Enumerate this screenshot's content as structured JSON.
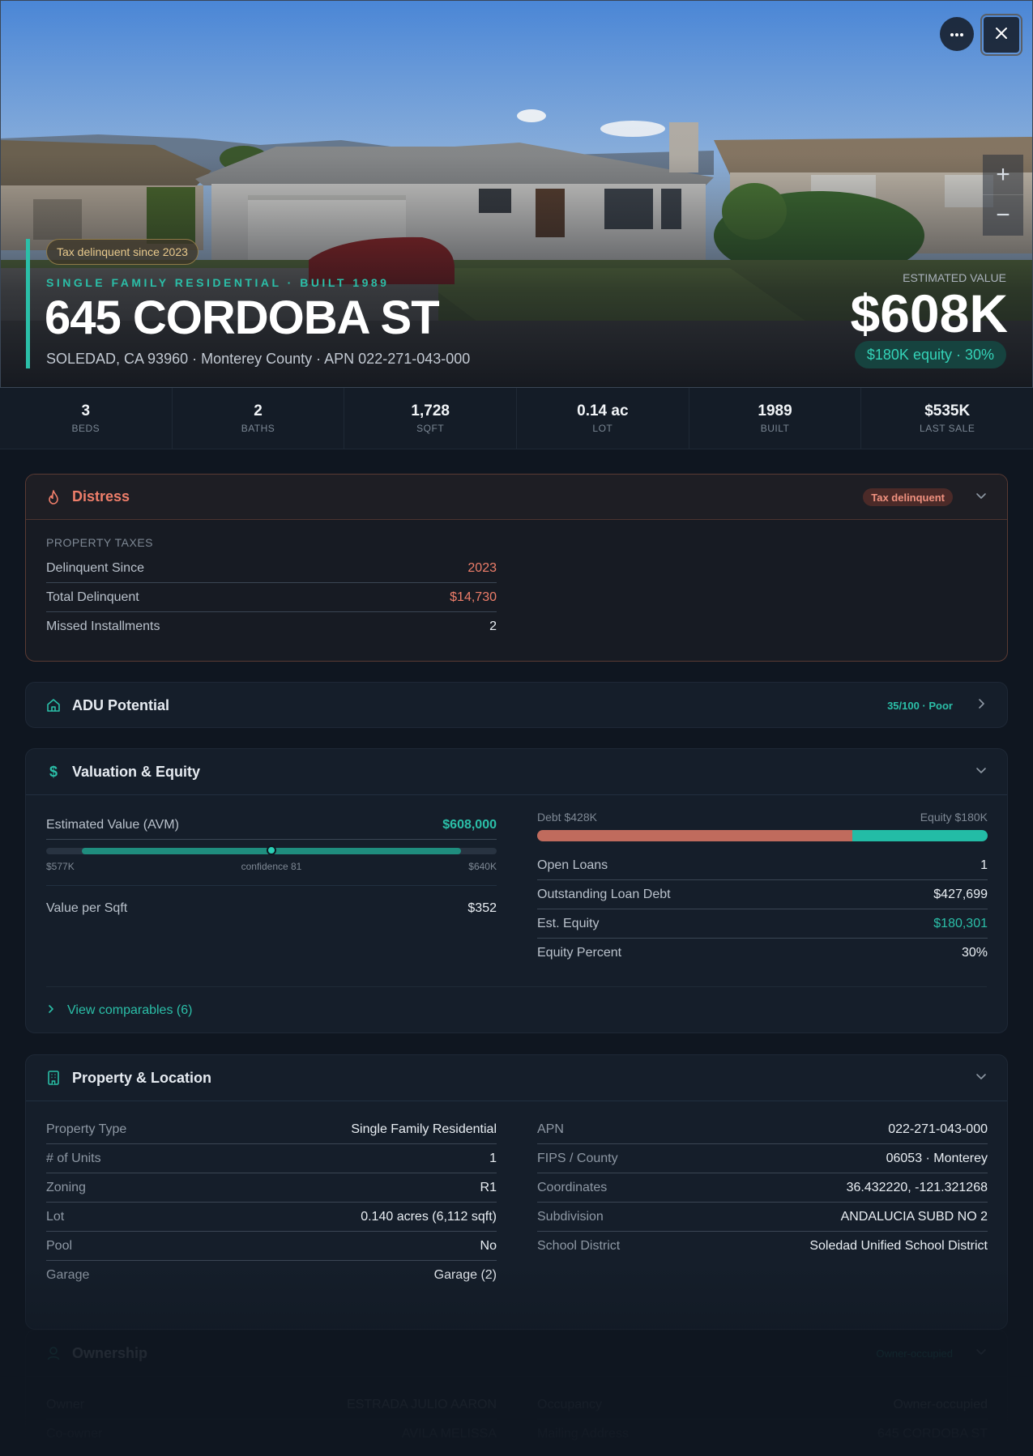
{
  "hero": {
    "tax_chip": "Tax delinquent since 2023",
    "property_type_line": "SINGLE FAMILY RESIDENTIAL · BUILT 1989",
    "address": "645 CORDOBA ST",
    "sub_address": "SOLEDAD, CA 93960 · Monterey County · APN 022-271-043-000",
    "estimated_value_label": "ESTIMATED VALUE",
    "estimated_value": "$608K",
    "equity_chip": "$180K equity · 30%",
    "more_icon": "more-horizontal-icon",
    "close_icon": "close-icon",
    "zoom_in_label": "+",
    "zoom_out_label": "−"
  },
  "stats": [
    {
      "value": "3",
      "label": "BEDS"
    },
    {
      "value": "2",
      "label": "BATHS"
    },
    {
      "value": "1,728",
      "label": "SQFT"
    },
    {
      "value": "0.14 ac",
      "label": "LOT"
    },
    {
      "value": "1989",
      "label": "BUILT"
    },
    {
      "value": "$535K",
      "label": "LAST SALE"
    }
  ],
  "distress": {
    "title": "Distress",
    "badge": "Tax delinquent",
    "section_label": "PROPERTY TAXES",
    "rows": [
      {
        "label": "Delinquent Since",
        "value": "2023"
      },
      {
        "label": "Total Delinquent",
        "value": "$14,730"
      },
      {
        "label": "Missed Installments",
        "value": "2"
      }
    ],
    "accent_color": "#ee7e6a"
  },
  "adu": {
    "title": "ADU Potential",
    "score": "35/100 · Poor"
  },
  "valuation": {
    "title": "Valuation & Equity",
    "avm_label": "Estimated Value (AVM)",
    "avm_value": "$608,000",
    "range_low": "$577K",
    "range_high": "$640K",
    "confidence": "confidence 81",
    "value_per_sqft_label": "Value per Sqft",
    "value_per_sqft": "$352",
    "debt_label": "Debt $428K",
    "equity_label": "Equity $180K",
    "debt_fraction": 0.7,
    "rows": [
      {
        "label": "Open Loans",
        "value": "1"
      },
      {
        "label": "Outstanding Loan Debt",
        "value": "$427,699"
      },
      {
        "label": "Est. Equity",
        "value": "$180,301"
      },
      {
        "label": "Equity Percent",
        "value": "30%"
      }
    ],
    "comparables_link": "View comparables (6)",
    "debt_color": "#c06b5d",
    "equity_color": "#23bca6"
  },
  "property": {
    "title": "Property & Location",
    "left": [
      {
        "label": "Property Type",
        "value": "Single Family Residential"
      },
      {
        "label": "# of Units",
        "value": "1"
      },
      {
        "label": "Zoning",
        "value": "R1"
      },
      {
        "label": "Lot",
        "value": "0.140 acres (6,112 sqft)"
      },
      {
        "label": "Pool",
        "value": "No"
      },
      {
        "label": "Garage",
        "value": "Garage (2)"
      }
    ],
    "right": [
      {
        "label": "APN",
        "value": "022-271-043-000"
      },
      {
        "label": "FIPS / County",
        "value": "06053 · Monterey"
      },
      {
        "label": "Coordinates",
        "value": "36.432220, -121.321268"
      },
      {
        "label": "Subdivision",
        "value": "ANDALUCIA SUBD NO 2"
      },
      {
        "label": "School District",
        "value": "Soledad Unified School District"
      }
    ]
  },
  "ownership": {
    "title": "Ownership",
    "badge": "Owner-occupied",
    "left": [
      {
        "label": "Owner",
        "value": "ESTRADA JULIO AARON"
      },
      {
        "label": "Co-owner",
        "value": "AVILA MELISSA"
      }
    ],
    "right": [
      {
        "label": "Occupancy",
        "value": "Owner-occupied"
      },
      {
        "label": "Mailing Address",
        "value": "645 CORDOBA ST"
      }
    ]
  },
  "colors": {
    "accent": "#2bbfa8",
    "background": "#0f1620",
    "card": "#151e2a"
  }
}
